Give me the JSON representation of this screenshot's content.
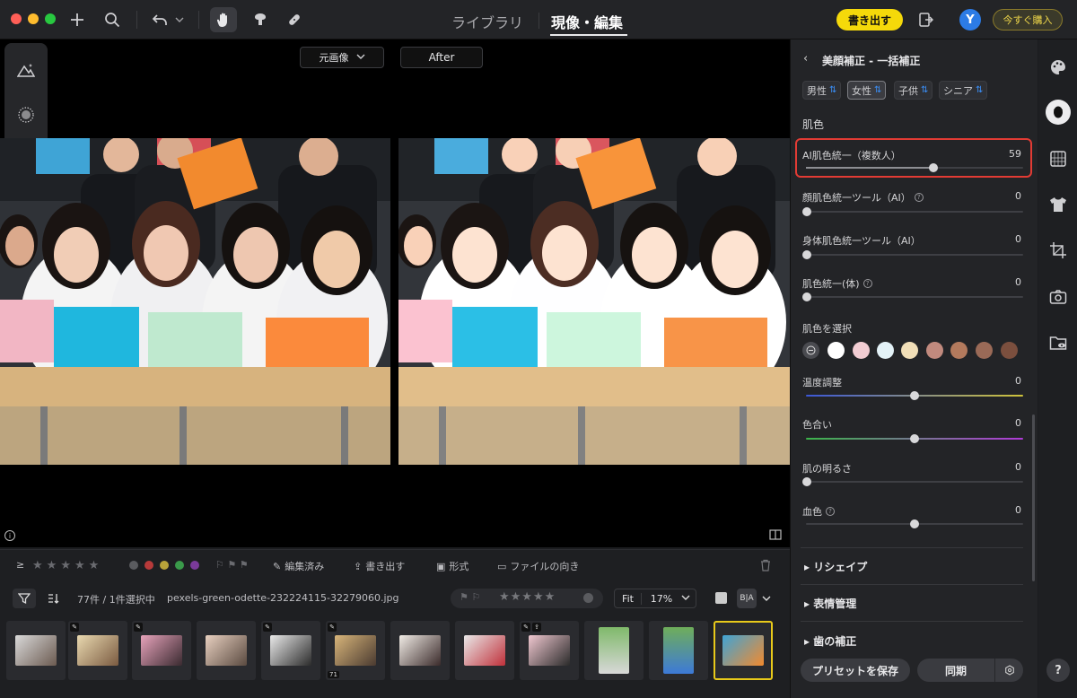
{
  "topbar": {
    "tabs": [
      {
        "label": "ライブラリ",
        "active": false
      },
      {
        "label": "現像・編集",
        "active": true
      }
    ],
    "export_label": "書き出す",
    "avatar_initial": "Y",
    "buy_label": "今すぐ購入"
  },
  "viewer": {
    "compare_select": "元画像",
    "after_label": "After"
  },
  "filmstrip": {
    "toolbar": {
      "rating_op": "≥",
      "edited_label": "編集済み",
      "export_label": "書き出す",
      "format_label": "形式",
      "orientation_label": "ファイルの向き"
    },
    "count_text": "77件 / 1件選択中",
    "filename": "pexels-green-odette-232224115-32279060.jpg",
    "fit_label": "Fit",
    "zoom_label": "17%",
    "thumb_badge_count": "71",
    "compare_icon_label": "B|A"
  },
  "panel": {
    "title": "美顔補正 - 一括補正",
    "chips": [
      {
        "label": "男性",
        "active": false
      },
      {
        "label": "女性",
        "active": true
      },
      {
        "label": "子供",
        "active": false
      },
      {
        "label": "シニア",
        "active": false
      }
    ],
    "section_skin": "肌色",
    "sliders": {
      "ai_unify": {
        "label": "AI肌色統一（複数人）",
        "value": "59"
      },
      "face_unify": {
        "label": "顔肌色統一ツール（AI）",
        "value": "0"
      },
      "body_unify": {
        "label": "身体肌色統一ツール（AI）",
        "value": "0"
      },
      "skin_unify_body": {
        "label": "肌色統一(体)",
        "value": "0"
      },
      "temperature": {
        "label": "温度調整",
        "value": "0"
      },
      "tint": {
        "label": "色合い",
        "value": "0"
      },
      "brightness": {
        "label": "肌の明るさ",
        "value": "0"
      },
      "blood": {
        "label": "血色",
        "value": "0"
      }
    },
    "select_skin_label": "肌色を選択",
    "swatch_colors": [
      "#ffffff",
      "#f2cdd3",
      "#e3f2f7",
      "#f1dfb8",
      "#c18a7e",
      "#b37a5d",
      "#9a6a57",
      "#7b4f3e",
      "#8a5a45"
    ],
    "collapsibles": [
      "リシェイプ",
      "表情管理",
      "歯の補正"
    ],
    "save_preset_label": "プリセットを保存",
    "sync_label": "同期"
  },
  "rail": {
    "help_label": "?"
  },
  "colors": {
    "accent_yellow": "#f5d90a",
    "highlight_red": "#e23b34",
    "avatar_blue": "#2c7be5"
  }
}
